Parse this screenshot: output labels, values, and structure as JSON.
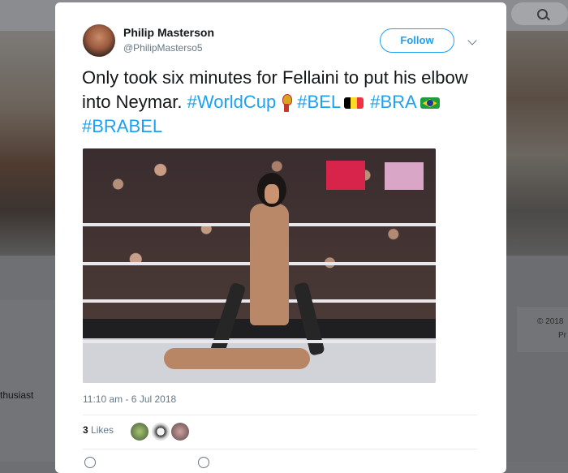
{
  "background": {
    "left_text": "thusiast",
    "right_copyright": "© 2018",
    "right_pr": "Pr"
  },
  "tweet": {
    "author_name": "Philip Masterson",
    "author_handle": "@PhilipMasterso5",
    "follow_label": "Follow",
    "text_part1": "Only took six minutes for Fellaini to put his elbow into Neymar. ",
    "hashtag_worldcup": "#WorldCup",
    "hashtag_bel": "#BEL",
    "hashtag_bra": "#BRA",
    "hashtag_brabel": "#BRABEL",
    "timestamp": "11:10 am - 6 Jul 2018",
    "likes_count": "3",
    "likes_label": "Likes"
  },
  "colors": {
    "accent": "#1da1f2",
    "text": "#14171a",
    "muted": "#657786",
    "belgium_flag": [
      "#000000",
      "#fdda24",
      "#ef3340"
    ]
  },
  "icons": [
    "search-icon",
    "chevron-down-icon",
    "trophy-emoji",
    "belgium-flag-emoji",
    "brazil-flag-emoji"
  ]
}
